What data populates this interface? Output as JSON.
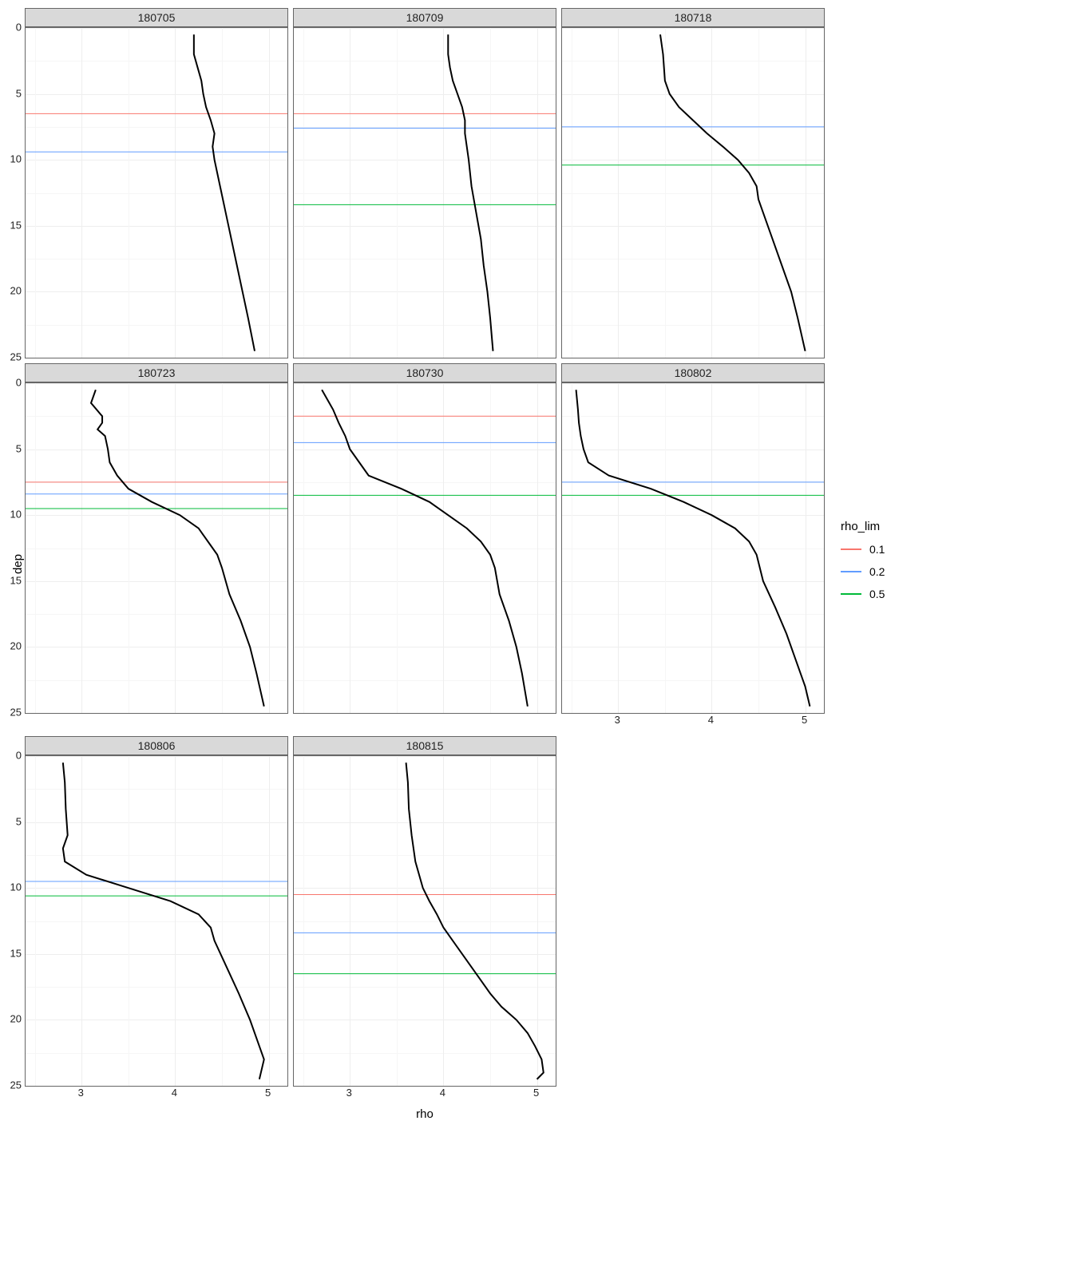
{
  "chart_data": {
    "type": "line",
    "facets": [
      "180705",
      "180709",
      "180718",
      "180723",
      "180730",
      "180802",
      "180806",
      "180815"
    ],
    "xlabel": "rho",
    "ylabel": "dep",
    "xlim": [
      2.4,
      5.2
    ],
    "ylim": [
      25,
      0
    ],
    "x_breaks_major": [
      3,
      4,
      5
    ],
    "x_breaks_minor": [
      2.5,
      3.5,
      4.5
    ],
    "y_breaks_major": [
      0,
      5,
      10,
      15,
      20,
      25
    ],
    "y_breaks_minor": [
      2.5,
      7.5,
      12.5,
      17.5,
      22.5
    ],
    "y_reversed": true,
    "legend": {
      "title": "rho_lim",
      "items": [
        {
          "label": "0.1",
          "color": "#F8766D"
        },
        {
          "label": "0.2",
          "color": "#619CFF"
        },
        {
          "label": "0.5",
          "color": "#00BA38"
        }
      ]
    },
    "hlines": {
      "180705": {
        "0.1": 6.5,
        "0.2": 9.4,
        "0.5": null
      },
      "180709": {
        "0.1": 6.5,
        "0.2": 7.6,
        "0.5": 13.4
      },
      "180718": {
        "0.1": null,
        "0.2": 7.5,
        "0.5": 10.4
      },
      "180723": {
        "0.1": 7.5,
        "0.2": 8.4,
        "0.5": 9.5
      },
      "180730": {
        "0.1": 2.5,
        "0.2": 4.5,
        "0.5": 8.5
      },
      "180802": {
        "0.1": null,
        "0.2": 7.5,
        "0.5": 8.5
      },
      "180806": {
        "0.1": null,
        "0.2": 9.5,
        "0.5": 10.6
      },
      "180815": {
        "0.1": 10.5,
        "0.2": 13.4,
        "0.5": 16.5
      }
    },
    "profiles": {
      "180705": [
        [
          4.2,
          0.5
        ],
        [
          4.2,
          2.0
        ],
        [
          4.24,
          3.0
        ],
        [
          4.28,
          4.0
        ],
        [
          4.3,
          5.0
        ],
        [
          4.33,
          6.0
        ],
        [
          4.38,
          7.0
        ],
        [
          4.42,
          8.0
        ],
        [
          4.4,
          9.0
        ],
        [
          4.42,
          10.0
        ],
        [
          4.48,
          12.0
        ],
        [
          4.54,
          14.0
        ],
        [
          4.6,
          16.0
        ],
        [
          4.66,
          18.0
        ],
        [
          4.72,
          20.0
        ],
        [
          4.78,
          22.0
        ],
        [
          4.85,
          24.5
        ]
      ],
      "180709": [
        [
          4.05,
          0.5
        ],
        [
          4.05,
          2.0
        ],
        [
          4.07,
          3.0
        ],
        [
          4.1,
          4.0
        ],
        [
          4.15,
          5.0
        ],
        [
          4.2,
          6.0
        ],
        [
          4.23,
          7.0
        ],
        [
          4.23,
          8.0
        ],
        [
          4.25,
          9.0
        ],
        [
          4.27,
          10.0
        ],
        [
          4.3,
          12.0
        ],
        [
          4.35,
          14.0
        ],
        [
          4.4,
          16.0
        ],
        [
          4.43,
          18.0
        ],
        [
          4.47,
          20.0
        ],
        [
          4.5,
          22.0
        ],
        [
          4.53,
          24.5
        ]
      ],
      "180718": [
        [
          3.45,
          0.5
        ],
        [
          3.48,
          2.0
        ],
        [
          3.5,
          4.0
        ],
        [
          3.55,
          5.0
        ],
        [
          3.65,
          6.0
        ],
        [
          3.8,
          7.0
        ],
        [
          3.95,
          8.0
        ],
        [
          4.12,
          9.0
        ],
        [
          4.28,
          10.0
        ],
        [
          4.4,
          11.0
        ],
        [
          4.48,
          12.0
        ],
        [
          4.5,
          13.0
        ],
        [
          4.55,
          14.0
        ],
        [
          4.65,
          16.0
        ],
        [
          4.75,
          18.0
        ],
        [
          4.85,
          20.0
        ],
        [
          4.92,
          22.0
        ],
        [
          5.0,
          24.5
        ]
      ],
      "180723": [
        [
          3.15,
          0.5
        ],
        [
          3.1,
          1.5
        ],
        [
          3.22,
          2.5
        ],
        [
          3.22,
          3.0
        ],
        [
          3.17,
          3.5
        ],
        [
          3.25,
          4.0
        ],
        [
          3.28,
          5.0
        ],
        [
          3.3,
          6.0
        ],
        [
          3.38,
          7.0
        ],
        [
          3.5,
          8.0
        ],
        [
          3.75,
          9.0
        ],
        [
          4.05,
          10.0
        ],
        [
          4.25,
          11.0
        ],
        [
          4.35,
          12.0
        ],
        [
          4.45,
          13.0
        ],
        [
          4.5,
          14.0
        ],
        [
          4.58,
          16.0
        ],
        [
          4.7,
          18.0
        ],
        [
          4.8,
          20.0
        ],
        [
          4.87,
          22.0
        ],
        [
          4.95,
          24.5
        ]
      ],
      "180730": [
        [
          2.7,
          0.5
        ],
        [
          2.78,
          1.5
        ],
        [
          2.82,
          2.0
        ],
        [
          2.88,
          3.0
        ],
        [
          2.95,
          4.0
        ],
        [
          3.0,
          5.0
        ],
        [
          3.1,
          6.0
        ],
        [
          3.2,
          7.0
        ],
        [
          3.55,
          8.0
        ],
        [
          3.85,
          9.0
        ],
        [
          4.05,
          10.0
        ],
        [
          4.25,
          11.0
        ],
        [
          4.4,
          12.0
        ],
        [
          4.5,
          13.0
        ],
        [
          4.55,
          14.0
        ],
        [
          4.6,
          16.0
        ],
        [
          4.7,
          18.0
        ],
        [
          4.78,
          20.0
        ],
        [
          4.84,
          22.0
        ],
        [
          4.9,
          24.5
        ]
      ],
      "180802": [
        [
          2.55,
          0.5
        ],
        [
          2.57,
          2.0
        ],
        [
          2.58,
          3.0
        ],
        [
          2.6,
          4.0
        ],
        [
          2.63,
          5.0
        ],
        [
          2.68,
          6.0
        ],
        [
          2.9,
          7.0
        ],
        [
          3.35,
          8.0
        ],
        [
          3.7,
          9.0
        ],
        [
          4.0,
          10.0
        ],
        [
          4.25,
          11.0
        ],
        [
          4.4,
          12.0
        ],
        [
          4.48,
          13.0
        ],
        [
          4.55,
          15.0
        ],
        [
          4.68,
          17.0
        ],
        [
          4.8,
          19.0
        ],
        [
          4.9,
          21.0
        ],
        [
          5.0,
          23.0
        ],
        [
          5.05,
          24.5
        ]
      ],
      "180806": [
        [
          2.8,
          0.5
        ],
        [
          2.82,
          2.0
        ],
        [
          2.83,
          4.0
        ],
        [
          2.85,
          6.0
        ],
        [
          2.8,
          7.0
        ],
        [
          2.82,
          8.0
        ],
        [
          3.05,
          9.0
        ],
        [
          3.5,
          10.0
        ],
        [
          3.95,
          11.0
        ],
        [
          4.25,
          12.0
        ],
        [
          4.38,
          13.0
        ],
        [
          4.42,
          14.0
        ],
        [
          4.55,
          16.0
        ],
        [
          4.68,
          18.0
        ],
        [
          4.8,
          20.0
        ],
        [
          4.9,
          22.0
        ],
        [
          4.95,
          23.0
        ],
        [
          4.9,
          24.5
        ]
      ],
      "180815": [
        [
          3.6,
          0.5
        ],
        [
          3.62,
          2.0
        ],
        [
          3.63,
          4.0
        ],
        [
          3.66,
          6.0
        ],
        [
          3.7,
          8.0
        ],
        [
          3.78,
          10.0
        ],
        [
          3.85,
          11.0
        ],
        [
          3.93,
          12.0
        ],
        [
          4.0,
          13.0
        ],
        [
          4.1,
          14.0
        ],
        [
          4.2,
          15.0
        ],
        [
          4.3,
          16.0
        ],
        [
          4.4,
          17.0
        ],
        [
          4.5,
          18.0
        ],
        [
          4.62,
          19.0
        ],
        [
          4.78,
          20.0
        ],
        [
          4.9,
          21.0
        ],
        [
          4.98,
          22.0
        ],
        [
          5.05,
          23.0
        ],
        [
          5.07,
          24.0
        ],
        [
          5.0,
          24.5
        ]
      ]
    }
  }
}
